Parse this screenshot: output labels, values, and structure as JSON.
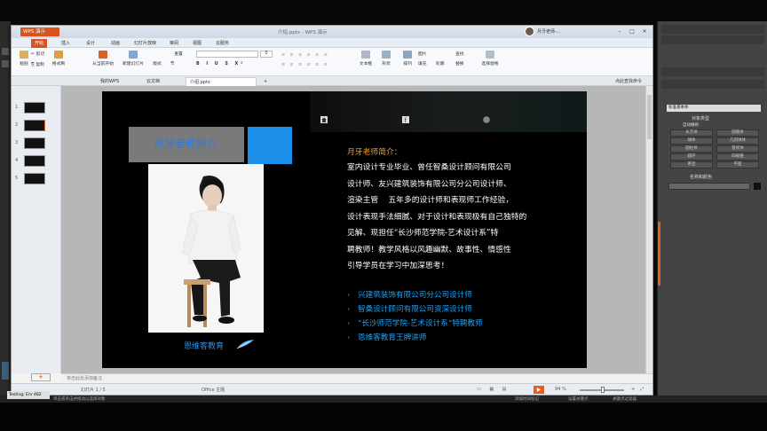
{
  "window": {
    "app_badge": "WPS 演示",
    "title": "介绍.pptx - WPS 演示",
    "user_name": "月牙老师-..."
  },
  "menu_tabs": [
    "开始",
    "插入",
    "设计",
    "动画",
    "幻灯片放映",
    "审阅",
    "视图",
    "云服务"
  ],
  "ribbon": {
    "paste": "粘贴",
    "cut": "剪切",
    "copy": "复制",
    "format_painter": "格式刷",
    "from_current": "从当前开始",
    "new_slide": "新建幻灯片",
    "layout": "版式",
    "section": "节",
    "reset": "重置",
    "textbox": "文本框",
    "shape": "形状",
    "arrange": "排列",
    "picture": "图片",
    "fill": "填充",
    "outline": "轮廓",
    "find": "查找",
    "replace": "替换",
    "select_pane": "选择窗格",
    "font_size": "0"
  },
  "doc_tabs": [
    "我的WPS",
    "云文档",
    "介绍.pptx"
  ],
  "doc_tab_right": "点此查找命令",
  "thumbnails": [
    "1",
    "2",
    "3",
    "4",
    "5"
  ],
  "slide": {
    "name_title": "月牙老师简介",
    "photo_caption": "恩维客教育",
    "intro_title": "月牙老师简介：",
    "intro_lines": [
      "室内设计专业毕业、曾任智桑设计顾问有限公司",
      "设计师、友兴建筑装饰有限公司分公司设计师、",
      "渲染主管    五年多的设计师和表现师工作经验，",
      "设计表现手法细腻、对于设计和表现极有自己独特的",
      "见解、现担任“长沙师范学院-艺术设计系”特",
      "聘教师！教学风格以风趣幽默、故事性、情感性",
      "引导学员在学习中加深思考！"
    ],
    "bullets": [
      "兴建筑装饰有限公司分公司设计师",
      "智桑设计顾问有限公司资深设计师",
      "“长沙师范学院-艺术设计系”特聘教师",
      "恩维客教育王牌讲师"
    ]
  },
  "notes_placeholder": "单击此处添加备注",
  "status": {
    "slide_count": "幻灯片 1 / 5",
    "theme": "Office 主题",
    "zoom": "94 %"
  },
  "max_panel": {
    "dropdown": "标准基本体",
    "section_object_type": "对象类型",
    "auto_grid": "自动栅格",
    "buttons": [
      "长方体",
      "圆锥体",
      "球体",
      "几何球体",
      "圆柱体",
      "管状体",
      "圆环",
      "四棱锥",
      "茶壶",
      "平面"
    ],
    "section_name_color": "名称和颜色"
  },
  "taskbar": {
    "editing_label": "Texting: Enr 482",
    "items": [
      "单击或单击并拖动以选择对象",
      "添加时间标记",
      "设置关键点",
      "关键点过滤器"
    ]
  }
}
